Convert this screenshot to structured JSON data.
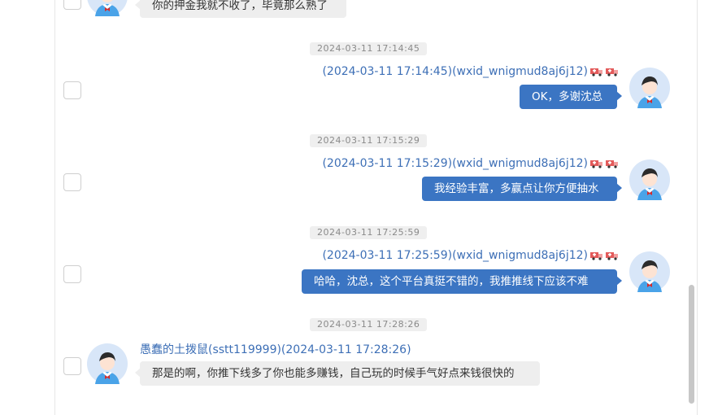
{
  "messages": [
    {
      "kind": "incoming",
      "text": "你的押金我就不收了，毕竟那么熟了"
    },
    {
      "kind": "outgoing",
      "timestamp": "2024-03-11 17:14:45",
      "header": "(2024-03-11 17:14:45)(wxid_wnigmud8aj6j12)",
      "text": "OK，多谢沈总"
    },
    {
      "kind": "outgoing",
      "timestamp": "2024-03-11 17:15:29",
      "header": "(2024-03-11 17:15:29)(wxid_wnigmud8aj6j12)",
      "text": "我经验丰富，多赢点让你方便抽水"
    },
    {
      "kind": "outgoing",
      "timestamp": "2024-03-11 17:25:59",
      "header": "(2024-03-11 17:25:59)(wxid_wnigmud8aj6j12)",
      "text": "哈哈，沈总，这个平台真挺不错的，我推推线下应该不难"
    },
    {
      "kind": "incoming",
      "timestamp": "2024-03-11 17:28:26",
      "header": "愚蠢的土拨鼠(sstt119999)(2024-03-11 17:28:26)",
      "text": "那是的啊，你推下线多了你也能多赚钱，自己玩的时候手气好点来钱很快的"
    }
  ],
  "icons": {
    "badge": "delivery-truck-icon",
    "avatar": "user-avatar-icon",
    "checkbox": "checkbox-icon"
  },
  "colors": {
    "accent": "#3b75c3",
    "link": "#3d6fb6",
    "avatar_bg": "#d8e6f8",
    "incoming_bubble": "#eeeeee"
  }
}
